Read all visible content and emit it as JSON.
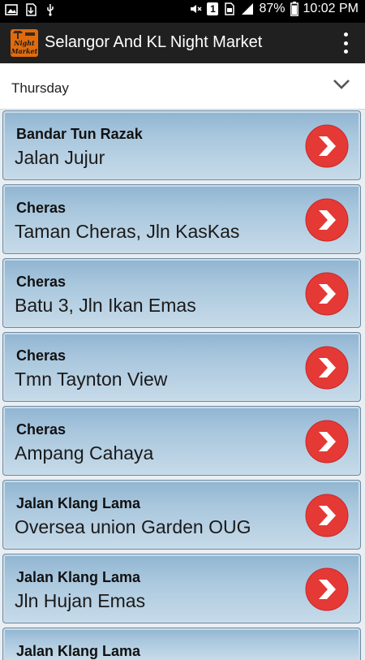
{
  "status_bar": {
    "battery": "87%",
    "time": "10:02 PM",
    "sim_badge": "1"
  },
  "app": {
    "title": "Selangor And KL Night Market",
    "logo_text_top": "Night",
    "logo_text_bottom": "Market"
  },
  "dropdown": {
    "selected": "Thursday"
  },
  "colors": {
    "accent_red": "#e53935",
    "list_blue": "#a8c6dd",
    "appbar": "#202020"
  },
  "markets": [
    {
      "area": "Bandar Tun Razak",
      "place": "Jalan Jujur"
    },
    {
      "area": "Cheras",
      "place": "Taman Cheras, Jln KasKas"
    },
    {
      "area": "Cheras",
      "place": "Batu 3, Jln Ikan Emas"
    },
    {
      "area": "Cheras",
      "place": "Tmn Taynton View"
    },
    {
      "area": "Cheras",
      "place": "Ampang Cahaya"
    },
    {
      "area": "Jalan Klang Lama",
      "place": "Oversea union Garden OUG"
    },
    {
      "area": "Jalan Klang Lama",
      "place": "Jln Hujan Emas"
    },
    {
      "area": "Jalan Klang Lama",
      "place": ""
    }
  ]
}
